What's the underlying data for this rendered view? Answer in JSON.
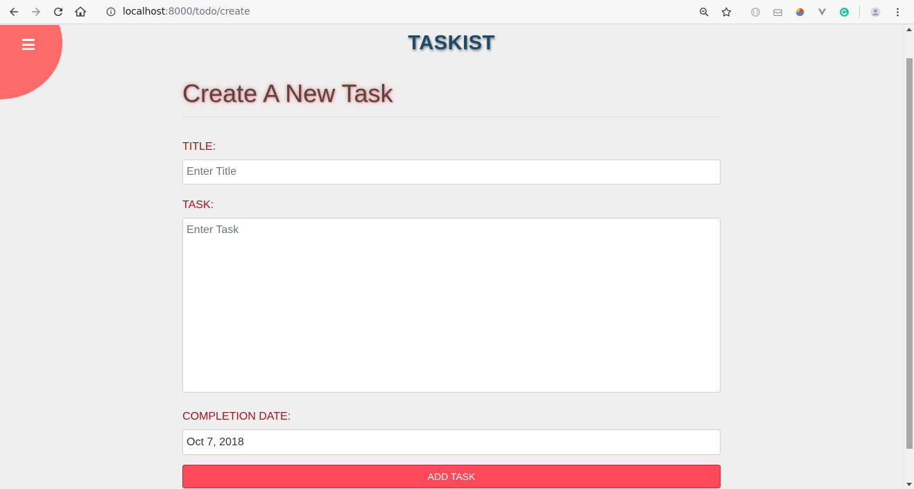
{
  "browser": {
    "url_host": "localhost",
    "url_path": ":8000/todo/create"
  },
  "page": {
    "brand": "TASKIST",
    "heading": "Create A New Task"
  },
  "form": {
    "title_label": "TITLE:",
    "title_placeholder": "Enter Title",
    "task_label": "TASK:",
    "task_placeholder": "Enter Task",
    "date_label": "COMPLETION DATE:",
    "date_value": "Oct 7, 2018",
    "submit_label": "ADD TASK"
  },
  "colors": {
    "menu_blob": "#fd6a6a",
    "brand": "#1d4a66",
    "label": "#a1141c",
    "button": "#ff4a5a"
  }
}
